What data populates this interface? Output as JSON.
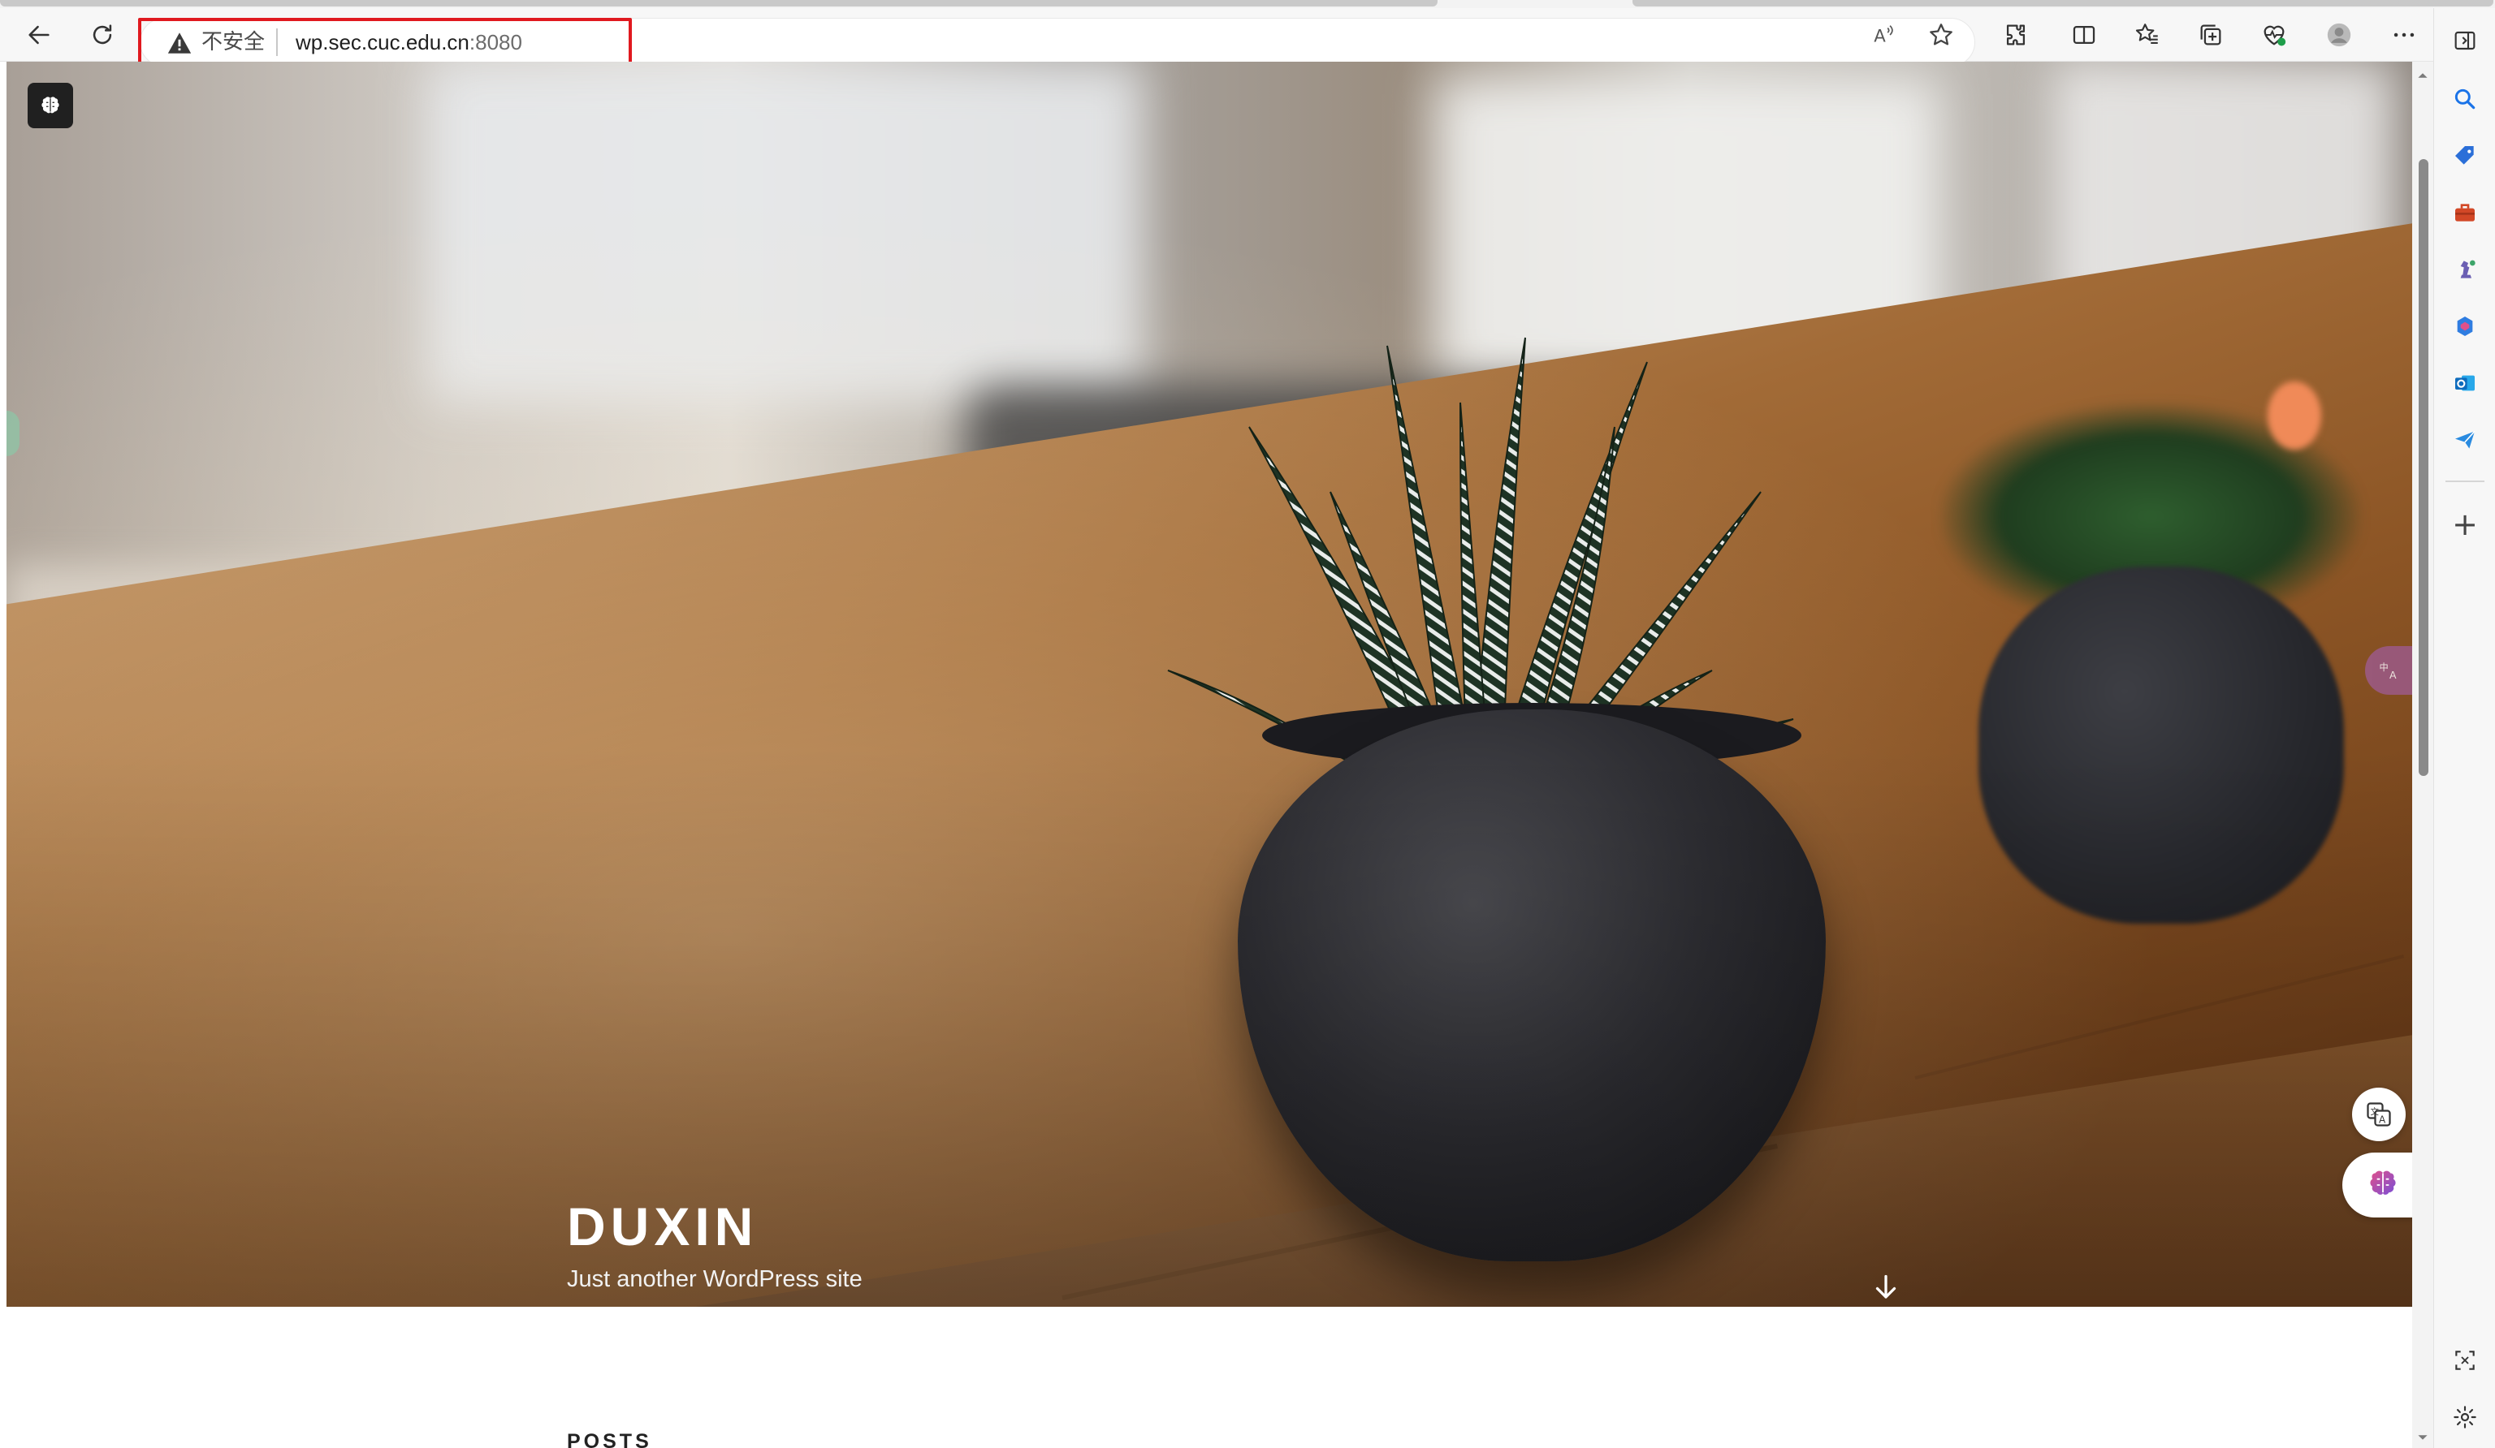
{
  "browser": {
    "address": {
      "security_label": "不安全",
      "url_host": "wp.sec.cuc.edu.cn",
      "url_port": ":8080"
    },
    "icons": {
      "back": "back-arrow-icon",
      "refresh": "refresh-icon",
      "read_aloud": "read-aloud-icon",
      "favorite": "star-icon",
      "extensions": "puzzle-icon",
      "split_screen": "split-screen-icon",
      "favorites": "favorites-icon",
      "collections": "collections-icon",
      "browser_essentials": "heart-pulse-icon",
      "profile": "avatar-icon",
      "more": "more-icon",
      "sidebar_toggle": "sidebar-toggle-icon"
    }
  },
  "sidebar": {
    "items": [
      {
        "name": "search",
        "color": "#1a73e8"
      },
      {
        "name": "shopping",
        "color": "#2b6fd8"
      },
      {
        "name": "tools",
        "color": "#d24726"
      },
      {
        "name": "games",
        "color": "#6b5fb3"
      },
      {
        "name": "copilot",
        "color": "#2f7de1"
      },
      {
        "name": "outlook",
        "color": "#0f6cbd"
      },
      {
        "name": "telegram",
        "color": "#2a8be0"
      }
    ],
    "add_label": "+"
  },
  "page": {
    "site_title": "DUXIN",
    "site_description": "Just another WordPress site",
    "posts_heading": "POSTS"
  },
  "colors": {
    "insecure_highlight": "#e0191f",
    "accent": "#1a73e8"
  }
}
